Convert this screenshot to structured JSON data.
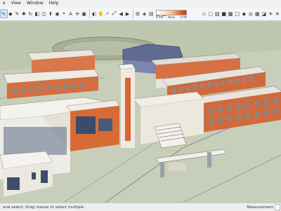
{
  "menu": {
    "items": [
      "e",
      "View",
      "Window",
      "Help"
    ]
  },
  "toolbar": {
    "tools": [
      {
        "name": "select-tool-icon",
        "glyph": "↖",
        "selected": true
      },
      {
        "name": "eraser-tool-icon",
        "glyph": "◆"
      },
      {
        "name": "line-tool-icon",
        "glyph": "✎"
      },
      {
        "name": "move-tool-icon",
        "glyph": "✚"
      },
      {
        "name": "rotate-tool-icon",
        "glyph": "↻"
      },
      {
        "name": "scale-tool-icon",
        "glyph": "◧"
      },
      {
        "name": "offset-tool-icon",
        "glyph": "◫"
      },
      {
        "name": "push-pull-tool-icon",
        "glyph": "⬆"
      },
      {
        "name": "follow-me-tool-icon",
        "glyph": "◉"
      },
      {
        "name": "tape-measure-icon",
        "glyph": "⌖"
      },
      {
        "name": "text-tool-icon",
        "glyph": "A"
      },
      {
        "name": "axes-tool-icon",
        "glyph": "✢"
      },
      {
        "name": "paint-bucket-icon",
        "glyph": "▣"
      },
      {
        "name": "orbit-tool-icon",
        "glyph": "◐"
      },
      {
        "name": "pan-tool-icon",
        "glyph": "✋"
      },
      {
        "name": "zoom-tool-icon",
        "glyph": "⌕"
      },
      {
        "name": "zoom-extents-icon",
        "glyph": "⤢"
      },
      {
        "name": "previous-view-icon",
        "glyph": "◀"
      },
      {
        "name": "next-view-icon",
        "glyph": "▶"
      },
      {
        "name": "top-view-icon",
        "glyph": "⊞"
      },
      {
        "name": "iso-view-icon",
        "glyph": "◈"
      },
      {
        "name": "front-view-icon",
        "glyph": "▤"
      },
      {
        "name": "right-view-icon",
        "glyph": "▥"
      },
      {
        "name": "back-view-icon",
        "glyph": "▦"
      }
    ],
    "tools_right": [
      {
        "name": "xray-style-icon",
        "glyph": "◇"
      },
      {
        "name": "wireframe-style-icon",
        "glyph": "▢"
      },
      {
        "name": "hidden-line-style-icon",
        "glyph": "▧"
      },
      {
        "name": "shaded-style-icon",
        "glyph": "■"
      },
      {
        "name": "textured-style-icon",
        "glyph": "▩"
      },
      {
        "name": "monochrome-style-icon",
        "glyph": "□"
      },
      {
        "name": "components-icon",
        "glyph": "◆"
      },
      {
        "name": "extension-warehouse-icon",
        "glyph": "◎"
      },
      {
        "name": "layout-icon",
        "glyph": "▦"
      },
      {
        "name": "sections-icon",
        "glyph": "◪"
      },
      {
        "name": "shadows-icon",
        "glyph": "☀"
      },
      {
        "name": "fog-icon",
        "glyph": "≋"
      }
    ],
    "scale_labels": [
      "6 AM",
      "Noon",
      "6 PM"
    ]
  },
  "status": {
    "text": "eral select. Drag mouse to select multiple.",
    "measurements_label": "Measurement"
  }
}
